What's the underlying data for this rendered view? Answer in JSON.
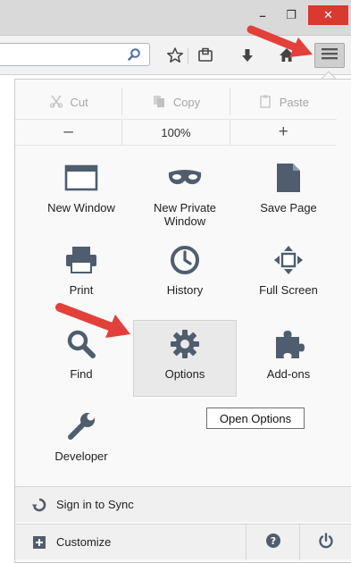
{
  "window": {
    "minimize_glyph": "–",
    "restore_glyph": "❐",
    "close_glyph": "✕"
  },
  "navbar": {
    "url_value": "",
    "icons": [
      "search-icon",
      "bookmark-star-icon",
      "bookmarks-menu-icon",
      "download-icon",
      "home-icon",
      "hamburger-menu-icon"
    ]
  },
  "edit": {
    "cut_label": "Cut",
    "copy_label": "Copy",
    "paste_label": "Paste"
  },
  "zoom": {
    "out_label": "–",
    "level": "100%",
    "in_label": "+"
  },
  "items": {
    "new_window": "New Window",
    "new_private_window": "New Private Window",
    "save_page": "Save Page",
    "print": "Print",
    "history": "History",
    "full_screen": "Full Screen",
    "find": "Find",
    "options": "Options",
    "add_ons": "Add-ons",
    "developer": "Developer"
  },
  "tooltip": "Open Options",
  "footer": {
    "sign_in": "Sign in to Sync",
    "customize": "Customize"
  },
  "colors": {
    "annotation_arrow": "#e2403a",
    "icon": "#4f5d6e",
    "close_button": "#d9392f"
  }
}
